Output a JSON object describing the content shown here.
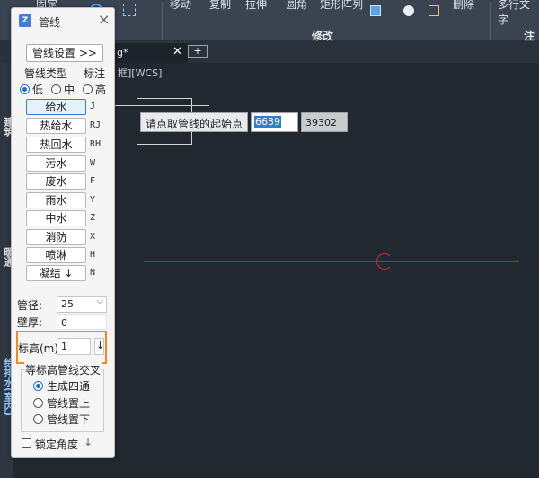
{
  "ribbon": {
    "items": [
      "固定",
      "移动",
      "复制",
      "拉伸",
      "圆角",
      "矩形阵列",
      "删除",
      "多行文字"
    ],
    "groups": [
      "修改",
      "注释"
    ]
  },
  "tabbar": {
    "active_tab": "g*",
    "close_glyph": "✕",
    "add_glyph": "+"
  },
  "left_strip": {
    "labels": [
      "建筑",
      "暖通",
      "给排水(室内)"
    ]
  },
  "viewport": {
    "label": "框][WCS]",
    "prompt": "请点取管线的起始点",
    "coord_x": "6639",
    "coord_y": "39302"
  },
  "dialog": {
    "title": "管线",
    "settings_button": "管线设置 >>",
    "type_label": "管线类型",
    "annot_label": "标注",
    "level_options": [
      {
        "label": "低",
        "checked": true
      },
      {
        "label": "中",
        "checked": false
      },
      {
        "label": "高",
        "checked": false
      }
    ],
    "pipe_types": [
      {
        "label": "给水",
        "code": "J",
        "selected": true
      },
      {
        "label": "热给水",
        "code": "RJ",
        "selected": false
      },
      {
        "label": "热回水",
        "code": "RH",
        "selected": false
      },
      {
        "label": "污水",
        "code": "W",
        "selected": false
      },
      {
        "label": "废水",
        "code": "F",
        "selected": false
      },
      {
        "label": "雨水",
        "code": "Y",
        "selected": false
      },
      {
        "label": "中水",
        "code": "Z",
        "selected": false
      },
      {
        "label": "消防",
        "code": "X",
        "selected": false
      },
      {
        "label": "喷淋",
        "code": "H",
        "selected": false
      },
      {
        "label": "凝结 ↓",
        "code": "N",
        "selected": false
      }
    ],
    "diameter_label": "管径:",
    "diameter_value": "25",
    "wall_label": "壁厚:",
    "wall_value": "0",
    "elevation_label": "标高(m)",
    "elevation_value": "1",
    "elevation_arrow": "↓",
    "cross_group_label": "等标高管线交叉",
    "cross_options": [
      {
        "label": "生成四通",
        "checked": true
      },
      {
        "label": "管线置上",
        "checked": false
      },
      {
        "label": "管线置下",
        "checked": false
      }
    ],
    "lock_angle_label": "锁定角度",
    "lock_angle_arrow": "↓"
  },
  "colors": {
    "accent": "#2f7ed8",
    "highlight": "#f28a1a",
    "redline": "#c02222"
  }
}
